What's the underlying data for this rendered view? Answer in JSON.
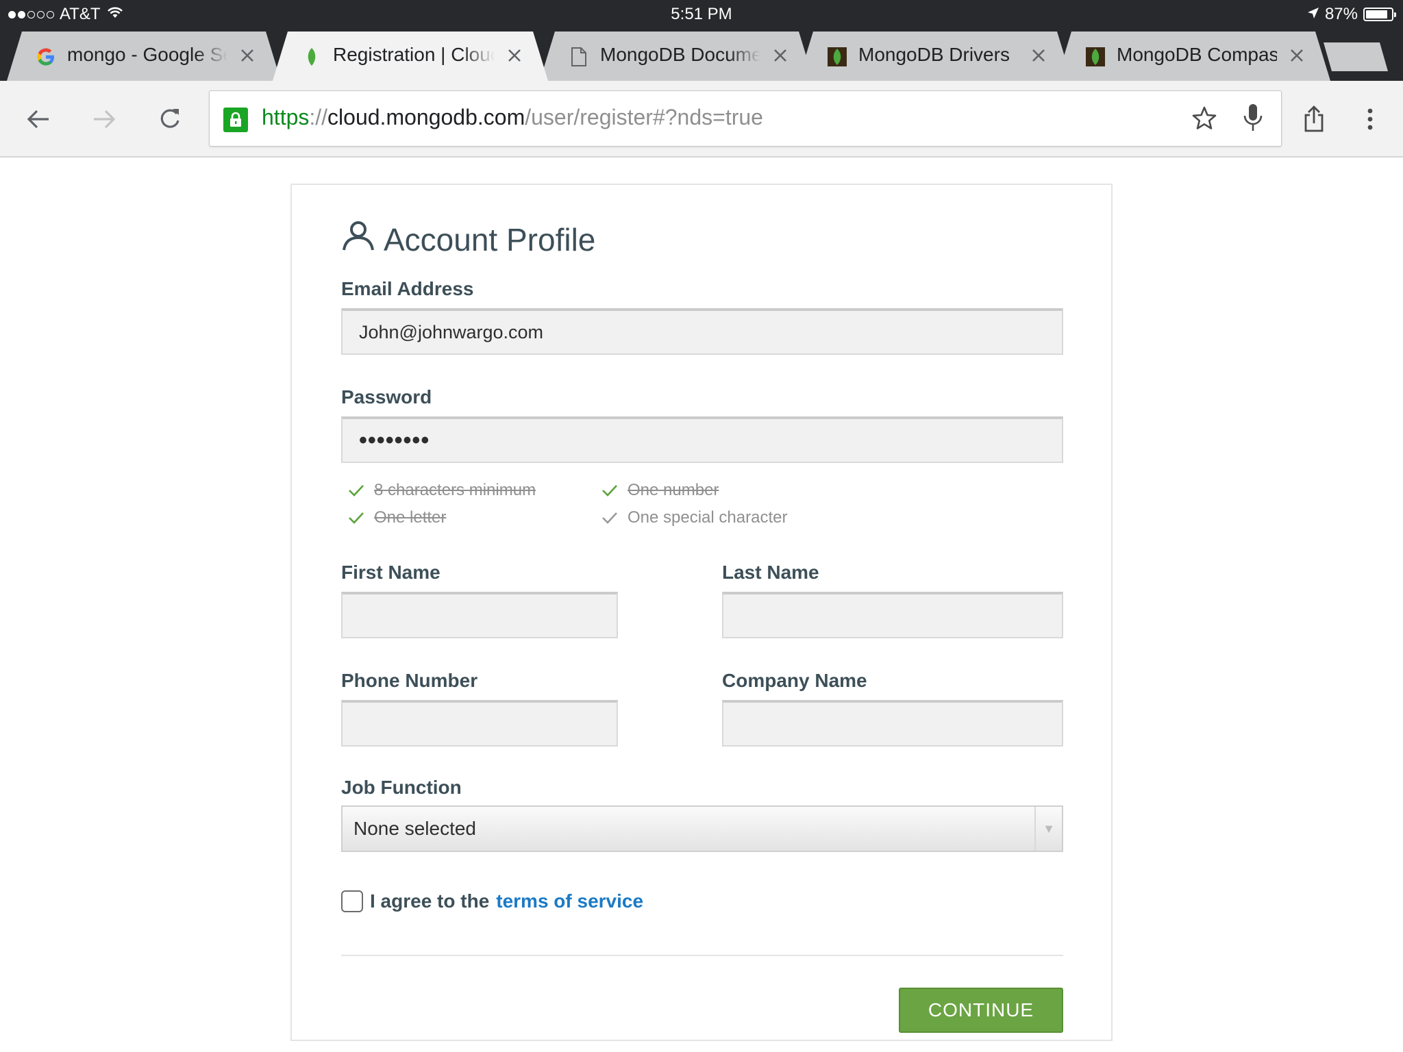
{
  "status_bar": {
    "carrier": "AT&T",
    "time": "5:51 PM",
    "battery": "87%"
  },
  "tabs": [
    {
      "title": "mongo - Google Sea",
      "favicon": "google-icon",
      "active": false
    },
    {
      "title": "Registration | Cloud:",
      "favicon": "mongodb-leaf-icon",
      "active": true
    },
    {
      "title": "MongoDB Documen",
      "favicon": "document-icon",
      "active": false
    },
    {
      "title": "MongoDB Drivers",
      "favicon": "mongodb-leaf-icon",
      "active": false
    },
    {
      "title": "MongoDB Compass",
      "favicon": "mongodb-leaf-icon",
      "active": false
    }
  ],
  "omnibox": {
    "scheme": "https",
    "separator": "://",
    "host": "cloud.mongodb.com",
    "path": "/user/register#?nds=true"
  },
  "form": {
    "heading": "Account Profile",
    "email": {
      "label": "Email Address",
      "value": "John@johnwargo.com"
    },
    "password": {
      "label": "Password",
      "value": "••••••••"
    },
    "requirements": [
      {
        "text": "8 characters minimum",
        "met": true
      },
      {
        "text": "One letter",
        "met": true
      },
      {
        "text": "One number",
        "met": true
      },
      {
        "text": "One special character",
        "met": false
      }
    ],
    "first_name": {
      "label": "First Name",
      "value": ""
    },
    "last_name": {
      "label": "Last Name",
      "value": ""
    },
    "phone": {
      "label": "Phone Number",
      "value": ""
    },
    "company": {
      "label": "Company Name",
      "value": ""
    },
    "job_function": {
      "label": "Job Function",
      "value": "None selected"
    },
    "agree": {
      "text": "I agree to the",
      "link": "terms of service",
      "checked": false
    },
    "continue_label": "CONTINUE"
  },
  "colors": {
    "accent_green": "#6ba443",
    "link_blue": "#1b7ac6",
    "check_green": "#5aa33b",
    "secure_green": "#0b8a1e"
  }
}
